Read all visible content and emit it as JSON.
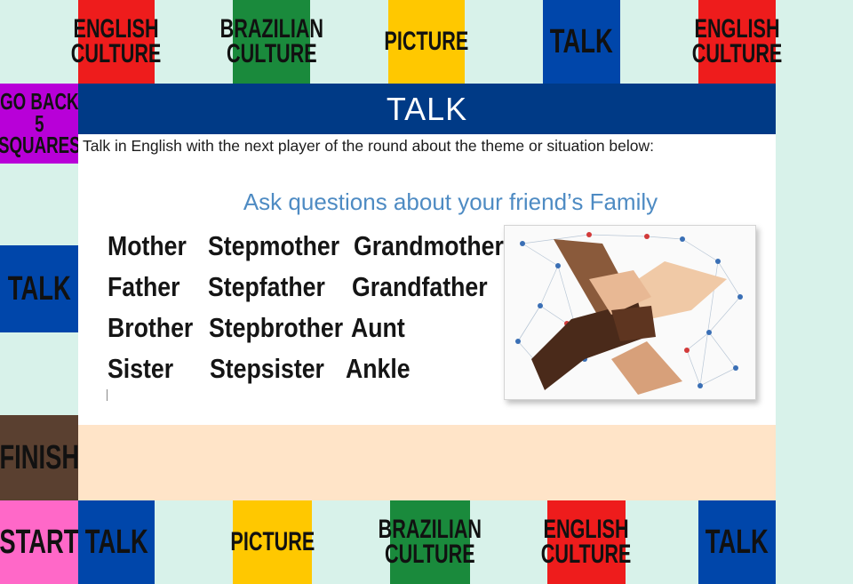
{
  "board": {
    "top": [
      {
        "label": "ENGLISH CULTURE",
        "color": "#ee1c1c"
      },
      {
        "label": "BRAZILIAN CULTURE",
        "color": "#1a8a3c"
      },
      {
        "label": "PICTURE",
        "color": "#ffc800"
      },
      {
        "label": "TALK",
        "color": "#0046aa"
      },
      {
        "label": "ENGLISH CULTURE",
        "color": "#ee1c1c"
      }
    ],
    "left": [
      {
        "label": "GO BACK 5 SQUARES",
        "color": "#b800d8"
      },
      {
        "label": "TALK",
        "color": "#0046aa"
      },
      {
        "label": "FINISH",
        "color": "#5a4030"
      },
      {
        "label": "START",
        "color": "#ff68c8"
      }
    ],
    "bottom": [
      {
        "label": "TALK",
        "color": "#0046aa"
      },
      {
        "label": "PICTURE",
        "color": "#ffc800"
      },
      {
        "label": "BRAZILIAN CULTURE",
        "color": "#1a8a3c"
      },
      {
        "label": "ENGLISH CULTURE",
        "color": "#ee1c1c"
      },
      {
        "label": "TALK",
        "color": "#0046aa"
      }
    ]
  },
  "card": {
    "title": "TALK",
    "instruction": "Talk in English with the next player of the round about the theme or situation below:",
    "subtitle": "Ask questions about your friend’s Family",
    "words": [
      [
        "Mother",
        "Stepmother",
        "Grandmother"
      ],
      [
        "Father",
        "Stepfather",
        "Grandfather"
      ],
      [
        "Brother",
        "Stepbrother",
        "Aunt"
      ],
      [
        "Sister",
        "Stepsister",
        "Ankle"
      ]
    ],
    "image": "linked-hands-network-picture"
  }
}
